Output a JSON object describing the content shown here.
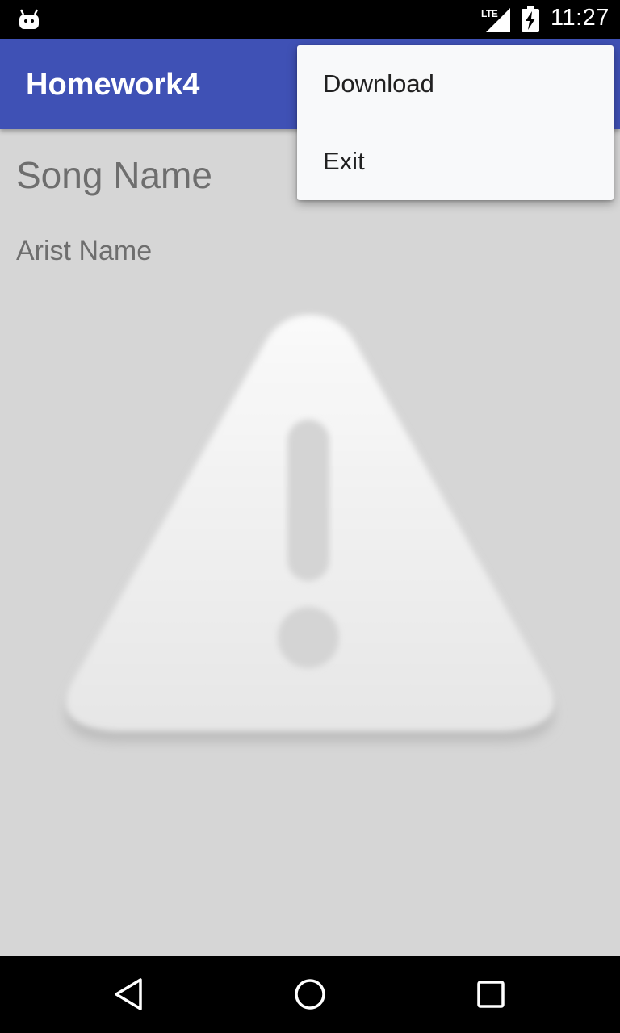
{
  "status_bar": {
    "network_label": "LTE",
    "time": "11:27",
    "icons": [
      "android-notification-icon",
      "lte-signal-icon",
      "battery-charging-icon"
    ]
  },
  "app_bar": {
    "title": "Homework4",
    "color": "#3f51b5"
  },
  "overflow_menu": {
    "items": [
      {
        "label": "Download"
      },
      {
        "label": "Exit"
      }
    ]
  },
  "content": {
    "song_name": "Song Name",
    "artist_name": "Arist Name",
    "image_icon": "warning-placeholder-icon"
  },
  "nav_bar": {
    "buttons": [
      "back-icon",
      "home-icon",
      "recents-icon"
    ]
  }
}
